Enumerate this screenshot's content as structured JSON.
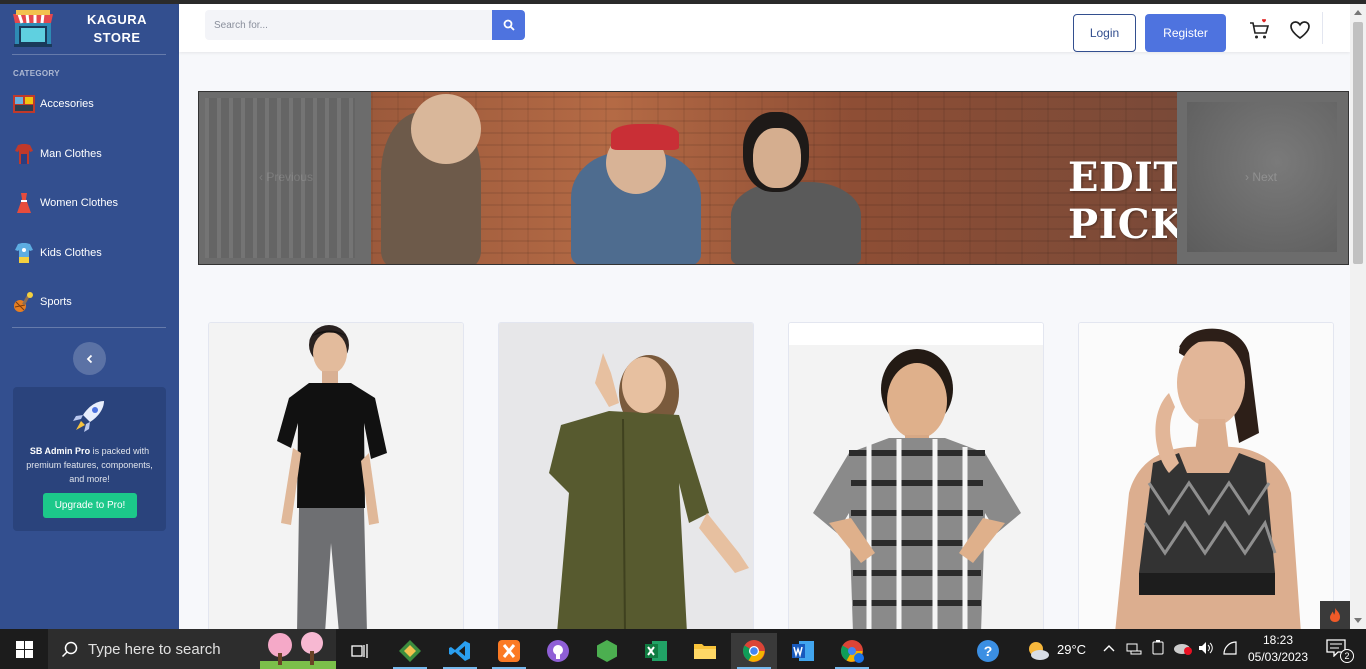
{
  "sidebar": {
    "brand_line1": "KAGURA",
    "brand_line2": "STORE",
    "category_title": "CATEGORY",
    "items": [
      {
        "label": "Accesories",
        "icon": "accessories-icon"
      },
      {
        "label": "Man Clothes",
        "icon": "man-clothes-icon"
      },
      {
        "label": "Women Clothes",
        "icon": "women-clothes-icon"
      },
      {
        "label": "Kids Clothes",
        "icon": "kids-clothes-icon"
      },
      {
        "label": "Sports",
        "icon": "sports-icon"
      }
    ],
    "promo": {
      "bold": "SB Admin Pro",
      "text": " is packed with premium features, components, and more!",
      "button": "Upgrade to Pro!"
    }
  },
  "topbar": {
    "search_placeholder": "Search for...",
    "login": "Login",
    "register": "Register"
  },
  "banner": {
    "headline": "EDITOR’S PICK",
    "prev": "‹ Previous",
    "next": "› Next"
  },
  "products": [
    {
      "alt": "Man in black polo shirt"
    },
    {
      "alt": "Woman in olive dress"
    },
    {
      "alt": "Boy in plaid shirt"
    },
    {
      "alt": "Woman in sports bra"
    }
  ],
  "taskbar": {
    "search_text": "Type here to search",
    "temperature": "29°C",
    "time": "18:23",
    "date": "05/03/2023",
    "notifications": "2"
  },
  "colors": {
    "sidebar": "#334f8f",
    "primary": "#4e73df",
    "success": "#1cc88a"
  }
}
